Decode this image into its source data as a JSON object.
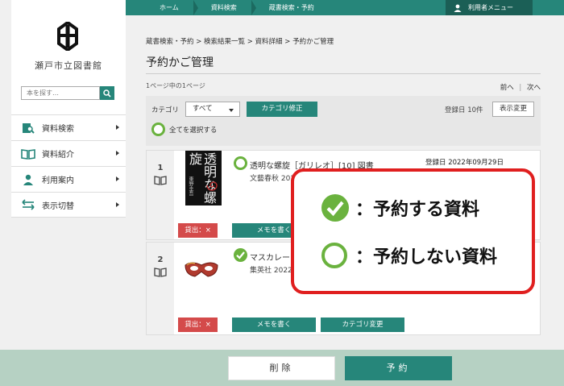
{
  "topnav": {
    "crumbs": [
      "ホーム",
      "資料検索",
      "蔵書検索・予約"
    ],
    "user_menu": "利用者メニュー"
  },
  "sidebar": {
    "library_name": "瀬戸市立図書館",
    "search_placeholder": "本を探す…",
    "menu": [
      {
        "label": "資料検索",
        "icon": "search-book-icon"
      },
      {
        "label": "資料紹介",
        "icon": "open-book-icon"
      },
      {
        "label": "利用案内",
        "icon": "person-icon"
      },
      {
        "label": "表示切替",
        "icon": "swap-arrows-icon"
      }
    ]
  },
  "main": {
    "breadcrumb": "蔵書検索・予約 > 検索結果一覧 > 資料詳細 > 予約かご管理",
    "title": "予約かご管理",
    "page_info": "1ページ中の1ページ",
    "prev": "前へ",
    "next": "次へ",
    "category_label": "カテゴリ",
    "category_value": "すべて",
    "category_edit": "カテゴリ修正",
    "reg_count": "登録日 10件",
    "display_change": "表示変更",
    "select_all": "全てを選択する"
  },
  "items": [
    {
      "num": "1",
      "cover_title": "透明な螺旋",
      "cover_author": "東野圭吾",
      "title": "透明な螺旋［ガリレオ］[10] 図書",
      "publisher": "文藝春秋 2021/",
      "reg_date": "登録日 2022年09月29日",
      "status": "貸出：×",
      "memo": "メモを書く",
      "selected": false
    },
    {
      "num": "2",
      "title": "マスカレー",
      "publisher": "集英社 2022/0",
      "status": "貸出：×",
      "memo": "メモを書く",
      "category_change": "カテゴリ変更",
      "selected": true
    }
  ],
  "legend": {
    "reserve": "：予約する資料",
    "not_reserve": "：予約しない資料"
  },
  "bottom": {
    "delete": "削除",
    "reserve": "予約"
  },
  "colors": {
    "accent": "#26867a",
    "check_green": "#6ab23e",
    "alert_red": "#d44a4a",
    "popup_border": "#e01f1f"
  }
}
